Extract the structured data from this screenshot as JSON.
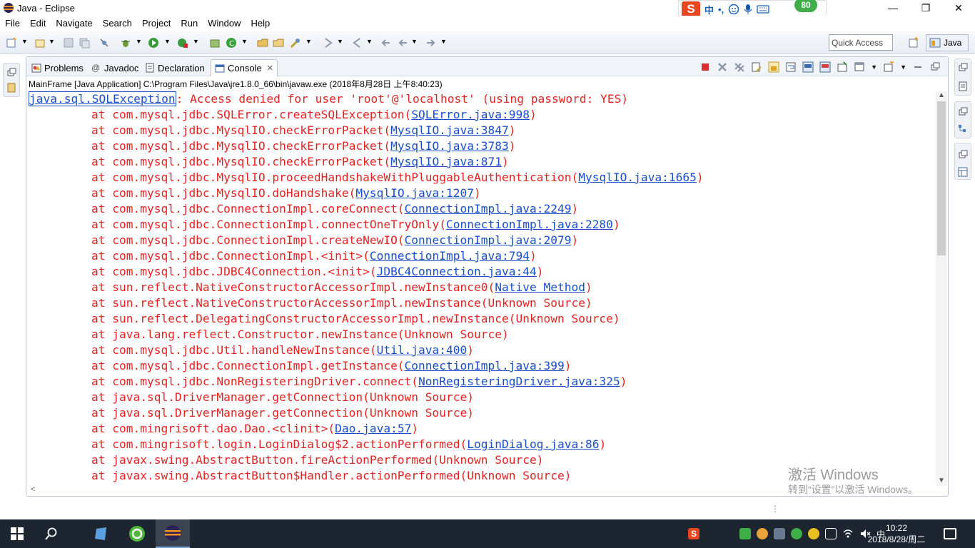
{
  "window": {
    "title": "Java - Eclipse",
    "controls": {
      "minimize": "—",
      "restore": "❐",
      "close": "✕"
    }
  },
  "ime": {
    "logo": "S",
    "lang": "中",
    "punct": "•,",
    "badge": "80"
  },
  "menu": [
    "File",
    "Edit",
    "Navigate",
    "Search",
    "Project",
    "Run",
    "Window",
    "Help"
  ],
  "toolbar": {
    "quick_access": "Quick Access",
    "perspective": "Java"
  },
  "tabs": [
    {
      "label": "Problems",
      "icon": "problems-icon"
    },
    {
      "label": "Javadoc",
      "icon": "javadoc-icon"
    },
    {
      "label": "Declaration",
      "icon": "declaration-icon"
    },
    {
      "label": "Console",
      "icon": "console-icon",
      "close": "✕"
    }
  ],
  "console": {
    "description": "MainFrame [Java Application] C:\\Program Files\\Java\\jre1.8.0_66\\bin\\javaw.exe (2018年8月28日 上午8:40:23)",
    "exception": {
      "name": "java.sql.SQLException",
      "message": ": Access denied for user 'root'@'localhost' (using password: YES)"
    },
    "frames": [
      {
        "method": "at com.mysql.jdbc.SQLError.createSQLException(",
        "link": "SQLError.java:998",
        "end": ")"
      },
      {
        "method": "at com.mysql.jdbc.MysqlIO.checkErrorPacket(",
        "link": "MysqlIO.java:3847",
        "end": ")"
      },
      {
        "method": "at com.mysql.jdbc.MysqlIO.checkErrorPacket(",
        "link": "MysqlIO.java:3783",
        "end": ")"
      },
      {
        "method": "at com.mysql.jdbc.MysqlIO.checkErrorPacket(",
        "link": "MysqlIO.java:871",
        "end": ")"
      },
      {
        "method": "at com.mysql.jdbc.MysqlIO.proceedHandshakeWithPluggableAuthentication(",
        "link": "MysqlIO.java:1665",
        "end": ")"
      },
      {
        "method": "at com.mysql.jdbc.MysqlIO.doHandshake(",
        "link": "MysqlIO.java:1207",
        "end": ")"
      },
      {
        "method": "at com.mysql.jdbc.ConnectionImpl.coreConnect(",
        "link": "ConnectionImpl.java:2249",
        "end": ")"
      },
      {
        "method": "at com.mysql.jdbc.ConnectionImpl.connectOneTryOnly(",
        "link": "ConnectionImpl.java:2280",
        "end": ")"
      },
      {
        "method": "at com.mysql.jdbc.ConnectionImpl.createNewIO(",
        "link": "ConnectionImpl.java:2079",
        "end": ")"
      },
      {
        "method": "at com.mysql.jdbc.ConnectionImpl.<init>(",
        "link": "ConnectionImpl.java:794",
        "end": ")"
      },
      {
        "method": "at com.mysql.jdbc.JDBC4Connection.<init>(",
        "link": "JDBC4Connection.java:44",
        "end": ")"
      },
      {
        "method": "at sun.reflect.NativeConstructorAccessorImpl.newInstance0(",
        "link": "Native Method",
        "end": ")"
      },
      {
        "method": "at sun.reflect.NativeConstructorAccessorImpl.newInstance(Unknown Source)",
        "link": "",
        "end": ""
      },
      {
        "method": "at sun.reflect.DelegatingConstructorAccessorImpl.newInstance(Unknown Source)",
        "link": "",
        "end": ""
      },
      {
        "method": "at java.lang.reflect.Constructor.newInstance(Unknown Source)",
        "link": "",
        "end": ""
      },
      {
        "method": "at com.mysql.jdbc.Util.handleNewInstance(",
        "link": "Util.java:400",
        "end": ")"
      },
      {
        "method": "at com.mysql.jdbc.ConnectionImpl.getInstance(",
        "link": "ConnectionImpl.java:399",
        "end": ")"
      },
      {
        "method": "at com.mysql.jdbc.NonRegisteringDriver.connect(",
        "link": "NonRegisteringDriver.java:325",
        "end": ")"
      },
      {
        "method": "at java.sql.DriverManager.getConnection(Unknown Source)",
        "link": "",
        "end": ""
      },
      {
        "method": "at java.sql.DriverManager.getConnection(Unknown Source)",
        "link": "",
        "end": ""
      },
      {
        "method": "at com.mingrisoft.dao.Dao.<clinit>(",
        "link": "Dao.java:57",
        "end": ")"
      },
      {
        "method": "at com.mingrisoft.login.LoginDialog$2.actionPerformed(",
        "link": "LoginDialog.java:86",
        "end": ")"
      },
      {
        "method": "at javax.swing.AbstractButton.fireActionPerformed(Unknown Source)",
        "link": "",
        "end": ""
      },
      {
        "method": "at javax.swing.AbstractButton$Handler.actionPerformed(Unknown Source)",
        "link": "",
        "end": ""
      }
    ]
  },
  "watermark": {
    "line1": "激活 Windows",
    "line2": "转到“设置”以激活 Windows。"
  },
  "taskbar": {
    "time": "10:22",
    "date": "2018/8/28/周二",
    "input_mode": "中"
  },
  "colors": {
    "error": "#e32323",
    "link": "#1a4ec9",
    "taskbar": "#1c2530"
  }
}
